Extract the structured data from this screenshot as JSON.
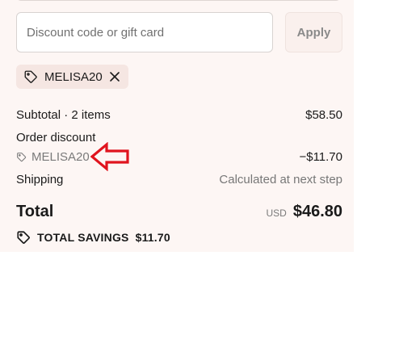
{
  "discount": {
    "placeholder": "Discount code or gift card",
    "value": "",
    "apply_label": "Apply"
  },
  "applied_code": {
    "code": "MELISA20",
    "icon": "tag-icon",
    "remove_icon": "close-icon"
  },
  "summary": {
    "subtotal_label": "Subtotal · 2 items",
    "subtotal_value": "$58.50",
    "order_discount_label": "Order discount",
    "order_discount_code": "MELISA20",
    "order_discount_value": "−$11.70",
    "shipping_label": "Shipping",
    "shipping_value": "Calculated at next step"
  },
  "total": {
    "label": "Total",
    "currency": "USD",
    "value": "$46.80"
  },
  "savings": {
    "label": "TOTAL SAVINGS",
    "value": "$11.70"
  },
  "annotation": {
    "arrow_color": "#e0141e",
    "icon": "red-arrow-icon"
  },
  "colors": {
    "panel_background": "#fdf6f4",
    "chip_background": "#f5e6e2",
    "apply_button_background": "#faf0ed"
  }
}
